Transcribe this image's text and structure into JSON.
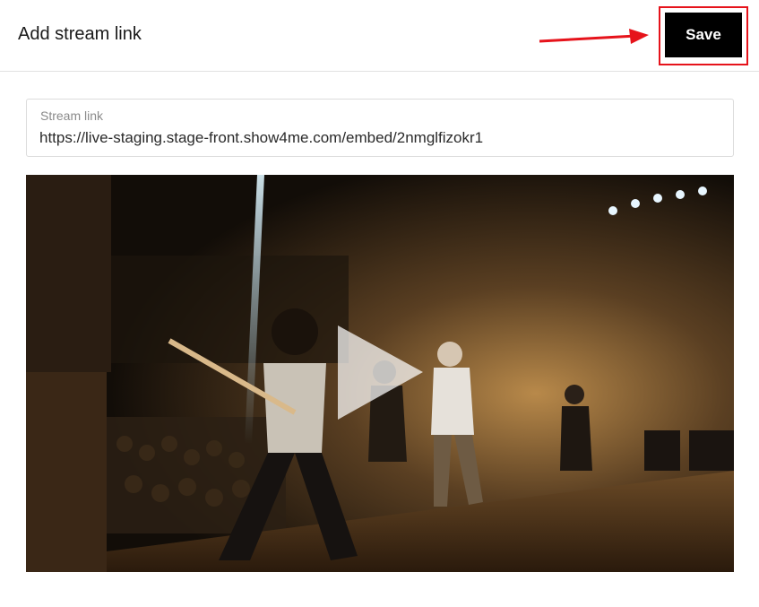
{
  "header": {
    "title": "Add stream link",
    "save_label": "Save"
  },
  "stream_field": {
    "label": "Stream link",
    "value": "https://live-staging.stage-front.show4me.com/embed/2nmglfizokr1"
  },
  "video": {
    "icon": "play-icon"
  },
  "colors": {
    "annotation": "#e6131b",
    "button_bg": "#000000",
    "button_text": "#ffffff"
  }
}
